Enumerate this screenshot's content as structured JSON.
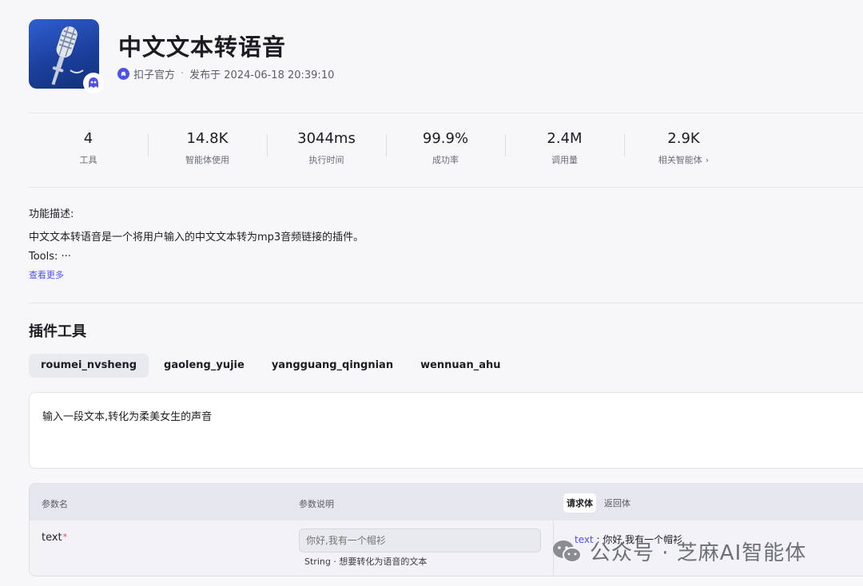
{
  "plugin": {
    "title": "中文文本转语音",
    "publisher": "扣子官方",
    "separator": "·",
    "published": "发布于 2024-06-18 20:39:10"
  },
  "stats": [
    {
      "value": "4",
      "label": "工具"
    },
    {
      "value": "14.8K",
      "label": "智能体使用"
    },
    {
      "value": "3044ms",
      "label": "执行时间"
    },
    {
      "value": "99.9%",
      "label": "成功率"
    },
    {
      "value": "2.4M",
      "label": "调用量"
    },
    {
      "value": "2.9K",
      "label": "相关智能体"
    }
  ],
  "description": {
    "heading": "功能描述:",
    "text": "中文文本转语音是一个将用户输入的中文文本转为mp3音频链接的插件。",
    "tools": "Tools: ···",
    "more": "查看更多"
  },
  "tools_section": {
    "title": "插件工具",
    "tabs": [
      "roumei_nvsheng",
      "gaoleng_yujie",
      "yangguang_qingnian",
      "wennuan_ahu"
    ],
    "active_tab": 0,
    "tool_description": "输入一段文本,转化为柔美女生的声音"
  },
  "params": {
    "col_name": "参数名",
    "col_desc": "参数说明",
    "tab_request": "请求体",
    "tab_response": "返回体",
    "row": {
      "name": "text",
      "required_mark": "*",
      "placeholder": "你好,我有一个帽衫",
      "type_line": "String · 想要转化为语音的文本",
      "request_key": "text",
      "request_value": " : 你好,我有一个帽衫"
    }
  },
  "watermark": "公众号 · 芝麻AI智能体",
  "colors": {
    "accent": "#4d53e8",
    "required": "#e5484d"
  }
}
